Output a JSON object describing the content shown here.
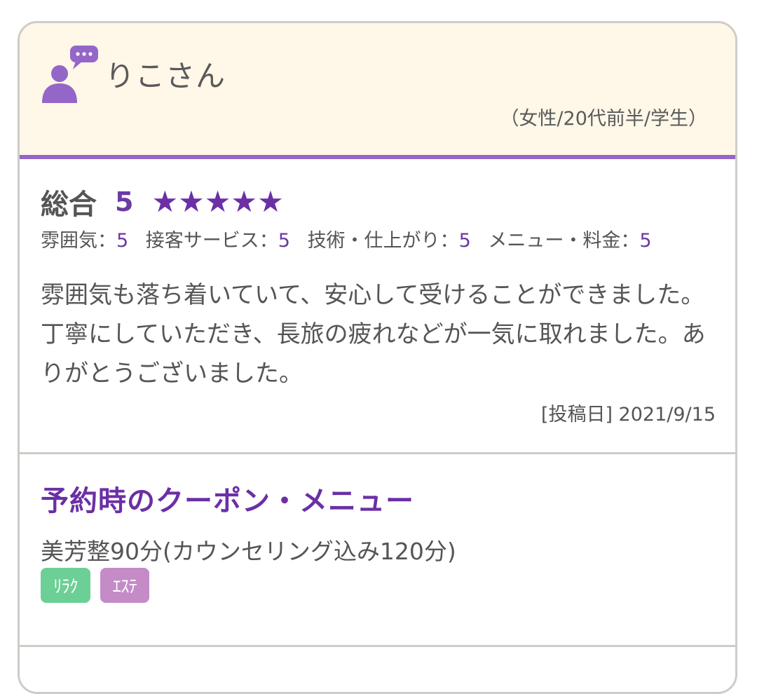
{
  "reviewer": {
    "name": "りこさん",
    "profile": "（女性/20代前半/学生）"
  },
  "rating": {
    "overall_label": "総合",
    "overall_score": "5",
    "stars": [
      "★",
      "★",
      "★",
      "★",
      "★"
    ],
    "sub_ratings": [
      {
        "label": "雰囲気：",
        "value": "5"
      },
      {
        "label": "接客サービス：",
        "value": "5"
      },
      {
        "label": "技術・仕上がり：",
        "value": "5"
      },
      {
        "label": "メニュー・料金：",
        "value": "5"
      }
    ]
  },
  "review": {
    "comment": "雰囲気も落ち着いていて、安心して受けることができました。丁寧にしていただき、長旅の疲れなどが一気に取れました。ありがとうございました。",
    "post_date": "[投稿日] 2021/9/15"
  },
  "coupon": {
    "title": "予約時のクーポン・メニュー",
    "menu": "美芳整90分(カウンセリング込み120分)",
    "tags": [
      {
        "label": "ﾘﾗｸ",
        "color": "#6ccf96"
      },
      {
        "label": "ｴｽﾃ",
        "color": "#c48bc7"
      }
    ]
  },
  "colors": {
    "accent": "#9466c8",
    "star": "#6b2fa6",
    "header_bg": "#fff7e8"
  }
}
